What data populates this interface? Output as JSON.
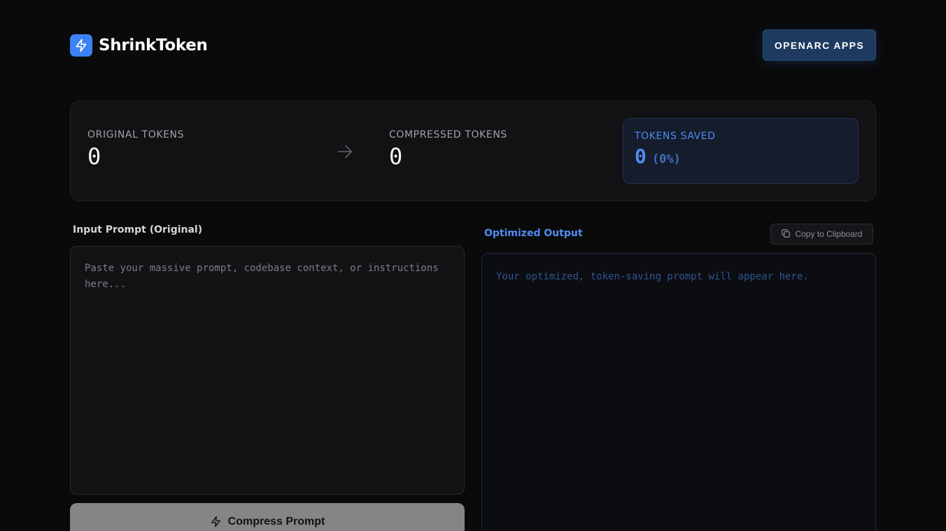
{
  "header": {
    "app_name": "ShrinkToken",
    "apps_button_label": "OPENARC APPS"
  },
  "stats": {
    "original": {
      "label": "ORIGINAL TOKENS",
      "value": "0"
    },
    "compressed": {
      "label": "COMPRESSED TOKENS",
      "value": "0"
    },
    "saved": {
      "label": "TOKENS SAVED",
      "value": "0",
      "percent": "(0%)"
    }
  },
  "input": {
    "label": "Input Prompt (Original)",
    "value": "",
    "placeholder": "Paste your massive prompt, codebase context, or instructions here...",
    "compress_button_label": "Compress Prompt"
  },
  "output": {
    "label": "Optimized Output",
    "copy_button_label": "Copy to Clipboard",
    "placeholder": "Your optimized, token-saving prompt will appear here."
  },
  "colors": {
    "accent": "#3b82f6",
    "accent_text": "#4f8cf0",
    "background": "#0a0a0b",
    "card": "#121214",
    "compress_button": "#858585"
  },
  "icons": {
    "brand": "lightning-bolt-icon",
    "arrow": "arrow-right-icon",
    "copy": "copy-icon",
    "compress": "lightning-bolt-icon"
  }
}
